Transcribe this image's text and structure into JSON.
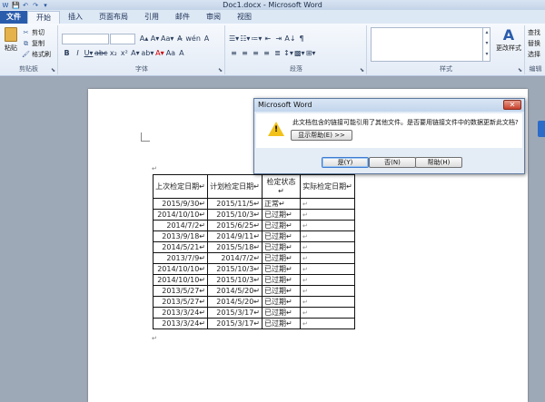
{
  "window": {
    "title": "Doc1.docx - Microsoft Word",
    "quick_access": [
      "W",
      "💾",
      "↶",
      "↷",
      "▾"
    ]
  },
  "tabs": [
    "文件",
    "开始",
    "插入",
    "页面布局",
    "引用",
    "邮件",
    "审阅",
    "视图"
  ],
  "ribbon": {
    "clipboard": {
      "paste": "粘贴",
      "cut": "剪切",
      "copy": "复制",
      "format_painter": "格式刷",
      "label": "剪贴板"
    },
    "font": {
      "label": "字体",
      "row1": [
        "A▴",
        "A▾",
        "Aa▾",
        "A̶",
        "wén",
        "A"
      ],
      "row2": [
        "B",
        "I",
        "U▾",
        "abc",
        "x₂",
        "x²",
        "A▾",
        "ab▾",
        "A▾",
        "Aa",
        "A"
      ]
    },
    "paragraph": {
      "label": "段落",
      "row1": [
        "☰▾",
        "☷▾",
        "≔▾",
        "⇤",
        "⇥",
        "A↓",
        "¶"
      ],
      "row2": [
        "≡",
        "≡",
        "≡",
        "≡",
        "≣",
        "↕▾",
        "▩▾",
        "⊞▾"
      ]
    },
    "styles": {
      "label": "样式",
      "change_styles": "更改样式"
    },
    "editing": {
      "label": "编辑",
      "find": "查找",
      "replace": "替换",
      "select": "选择"
    }
  },
  "dialog": {
    "title": "Microsoft Word",
    "close": "✕",
    "message": "此文档包含的链接可能引用了其他文件。是否要用链接文件中的数据更新此文档?",
    "show_help": "显示帮助(E) >>",
    "yes": "是(Y)",
    "no": "否(N)",
    "help": "帮助(H)"
  },
  "marks": {
    "paragraph": "↵"
  },
  "table": {
    "headers": [
      "上次检定日期↵",
      "计划检定日期↵",
      "检定状态↵",
      "实际检定日期↵"
    ],
    "rows": [
      [
        "2015/9/30↵",
        "2015/11/5↵",
        "正常↵",
        "↵"
      ],
      [
        "2014/10/10↵",
        "2015/10/3↵",
        "已过期↵",
        "↵"
      ],
      [
        "2014/7/2↵",
        "2015/6/25↵",
        "已过期↵",
        "↵"
      ],
      [
        "2013/9/18↵",
        "2014/9/11↵",
        "已过期↵",
        "↵"
      ],
      [
        "2014/5/21↵",
        "2015/5/18↵",
        "已过期↵",
        "↵"
      ],
      [
        "2013/7/9↵",
        "2014/7/2↵",
        "已过期↵",
        "↵"
      ],
      [
        "2014/10/10↵",
        "2015/10/3↵",
        "已过期↵",
        "↵"
      ],
      [
        "2014/10/10↵",
        "2015/10/3↵",
        "已过期↵",
        "↵"
      ],
      [
        "2013/5/27↵",
        "2014/5/20↵",
        "已过期↵",
        "↵"
      ],
      [
        "2013/5/27↵",
        "2014/5/20↵",
        "已过期↵",
        "↵"
      ],
      [
        "2013/3/24↵",
        "2015/3/17↵",
        "已过期↵",
        "↵"
      ],
      [
        "2013/3/24↵",
        "2015/3/17↵",
        "已过期↵",
        "↵"
      ]
    ]
  }
}
